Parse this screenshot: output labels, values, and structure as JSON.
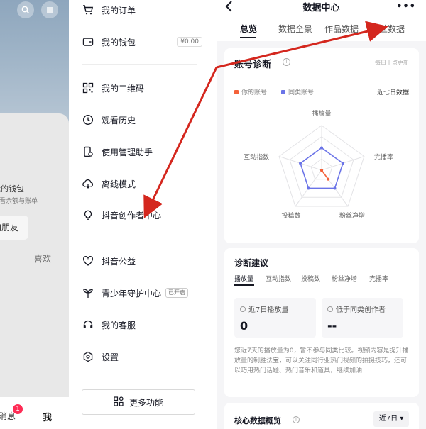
{
  "background_screen": {
    "wallet_title": "我的钱包",
    "wallet_subtitle": "查看余额与账单",
    "add_friend_label": "加朋友",
    "likes_tab_label": "喜欢",
    "message_tab_label": "消息",
    "message_badge": "1",
    "me_tab_label": "我"
  },
  "drawer": {
    "items": [
      {
        "label": "我的订单",
        "icon": "cart-icon"
      },
      {
        "label": "我的钱包",
        "icon": "wallet-icon",
        "value": "¥0.00"
      },
      {
        "label": "我的二维码",
        "icon": "qrcode-icon"
      },
      {
        "label": "观看历史",
        "icon": "clock-icon"
      },
      {
        "label": "使用管理助手",
        "icon": "phone-manage-icon"
      },
      {
        "label": "离线模式",
        "icon": "cloud-download-icon"
      },
      {
        "label": "抖音创作者中心",
        "icon": "bulb-icon"
      },
      {
        "label": "抖音公益",
        "icon": "heart-hands-icon"
      },
      {
        "label": "青少年守护中心",
        "icon": "sprout-icon",
        "tag": "已开启"
      },
      {
        "label": "我的客服",
        "icon": "headset-icon"
      },
      {
        "label": "设置",
        "icon": "gear-icon"
      }
    ],
    "more_button_label": "更多功能"
  },
  "data_center": {
    "title": "数据中心",
    "tabs": [
      "总览",
      "数据全景",
      "作品数据",
      "粉丝数据"
    ],
    "active_tab": 0,
    "diagnosis": {
      "title": "账号诊断",
      "update_note": "每日十点更新",
      "legend_self": "你的账号",
      "legend_peer": "同类账号",
      "period": "近七日数据"
    },
    "advice": {
      "title": "诊断建议",
      "tabs": [
        "播放量",
        "互动指数",
        "投稿数",
        "粉丝净增",
        "完播率"
      ],
      "metric_left_label": "近7日播放量",
      "metric_left_value": "0",
      "metric_right_label": "低于同类创作者",
      "metric_right_value": "--",
      "text": "您近7天的播放量为0，暂不参与同类比较。视频内容是提升播放量的制胜法宝，可以关注同行业热门视频的拍摄技巧，还可以巧用热门话题、热门音乐和道具，继续加油"
    },
    "core": {
      "title": "核心数据概览",
      "period": "近7日 ▾"
    }
  },
  "colors": {
    "self_series": "#f4623a",
    "peer_series": "#6b74e8",
    "arrow": "#d4271e",
    "badge": "#fe2c55"
  },
  "chart_data": {
    "type": "radar",
    "axes": [
      "播放量",
      "完播率",
      "粉丝净增",
      "投稿数",
      "互动指数"
    ],
    "series": [
      {
        "name": "你的账号",
        "values": [
          0,
          0,
          0.25,
          0,
          0
        ]
      },
      {
        "name": "同类账号",
        "values": [
          0.5,
          0.5,
          0.5,
          0.5,
          0.5
        ]
      }
    ],
    "max": 1,
    "levels": 4
  }
}
